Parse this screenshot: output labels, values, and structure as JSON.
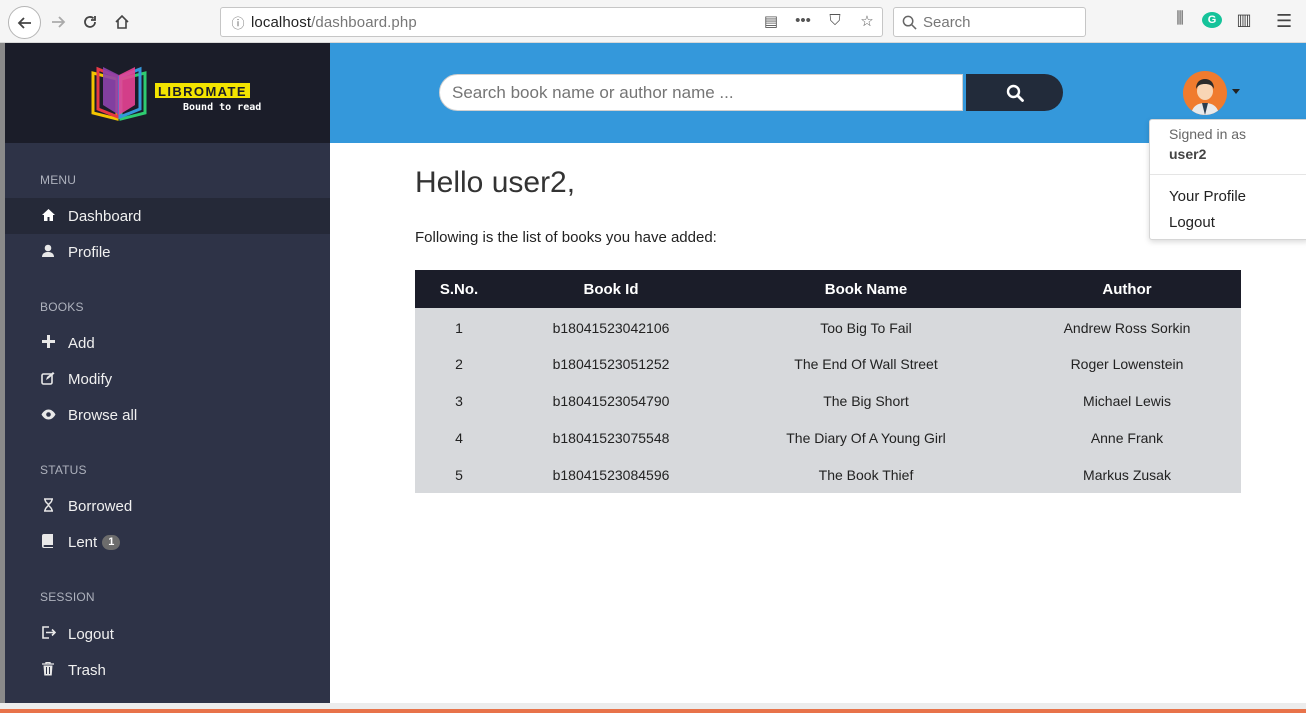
{
  "browser": {
    "url_host": "localhost",
    "url_path": "/dashboard.php",
    "search_placeholder": "Search"
  },
  "brand": {
    "name": "LIBROMATE",
    "tagline": "Bound to read"
  },
  "sidebar": {
    "sections": [
      {
        "title": "MENU",
        "items": [
          {
            "label": "Dashboard",
            "icon": "home-icon",
            "active": true
          },
          {
            "label": "Profile",
            "icon": "user-icon"
          }
        ]
      },
      {
        "title": "BOOKS",
        "items": [
          {
            "label": "Add",
            "icon": "plus-icon"
          },
          {
            "label": "Modify",
            "icon": "edit-icon"
          },
          {
            "label": "Browse all",
            "icon": "eye-icon"
          }
        ]
      },
      {
        "title": "STATUS",
        "items": [
          {
            "label": "Borrowed",
            "icon": "hourglass-icon"
          },
          {
            "label": "Lent",
            "icon": "book-icon",
            "badge": "1"
          }
        ]
      },
      {
        "title": "SESSION",
        "items": [
          {
            "label": "Logout",
            "icon": "logout-icon"
          },
          {
            "label": "Trash",
            "icon": "trash-icon"
          }
        ]
      }
    ]
  },
  "header": {
    "search_placeholder": "Search book name or author name ..."
  },
  "user_menu": {
    "signed_in_label": "Signed in as",
    "username": "user2",
    "items": [
      "Your Profile",
      "Logout"
    ]
  },
  "main": {
    "greeting": "Hello user2,",
    "subtext": "Following is the list of books you have added:",
    "table": {
      "headers": [
        "S.No.",
        "Book Id",
        "Book Name",
        "Author"
      ],
      "rows": [
        [
          "1",
          "b18041523042106",
          "Too Big To Fail",
          "Andrew Ross Sorkin"
        ],
        [
          "2",
          "b18041523051252",
          "The End Of Wall Street",
          "Roger Lowenstein"
        ],
        [
          "3",
          "b18041523054790",
          "The Big Short",
          "Michael Lewis"
        ],
        [
          "4",
          "b18041523075548",
          "The Diary Of A Young Girl",
          "Anne Frank"
        ],
        [
          "5",
          "b18041523084596",
          "The Book Thief",
          "Markus Zusak"
        ]
      ]
    }
  },
  "colors": {
    "header_blue": "#3498db",
    "sidebar": "#2e3347",
    "sidebar_dark": "#1b1d29",
    "table_row": "#d7d9dc"
  }
}
